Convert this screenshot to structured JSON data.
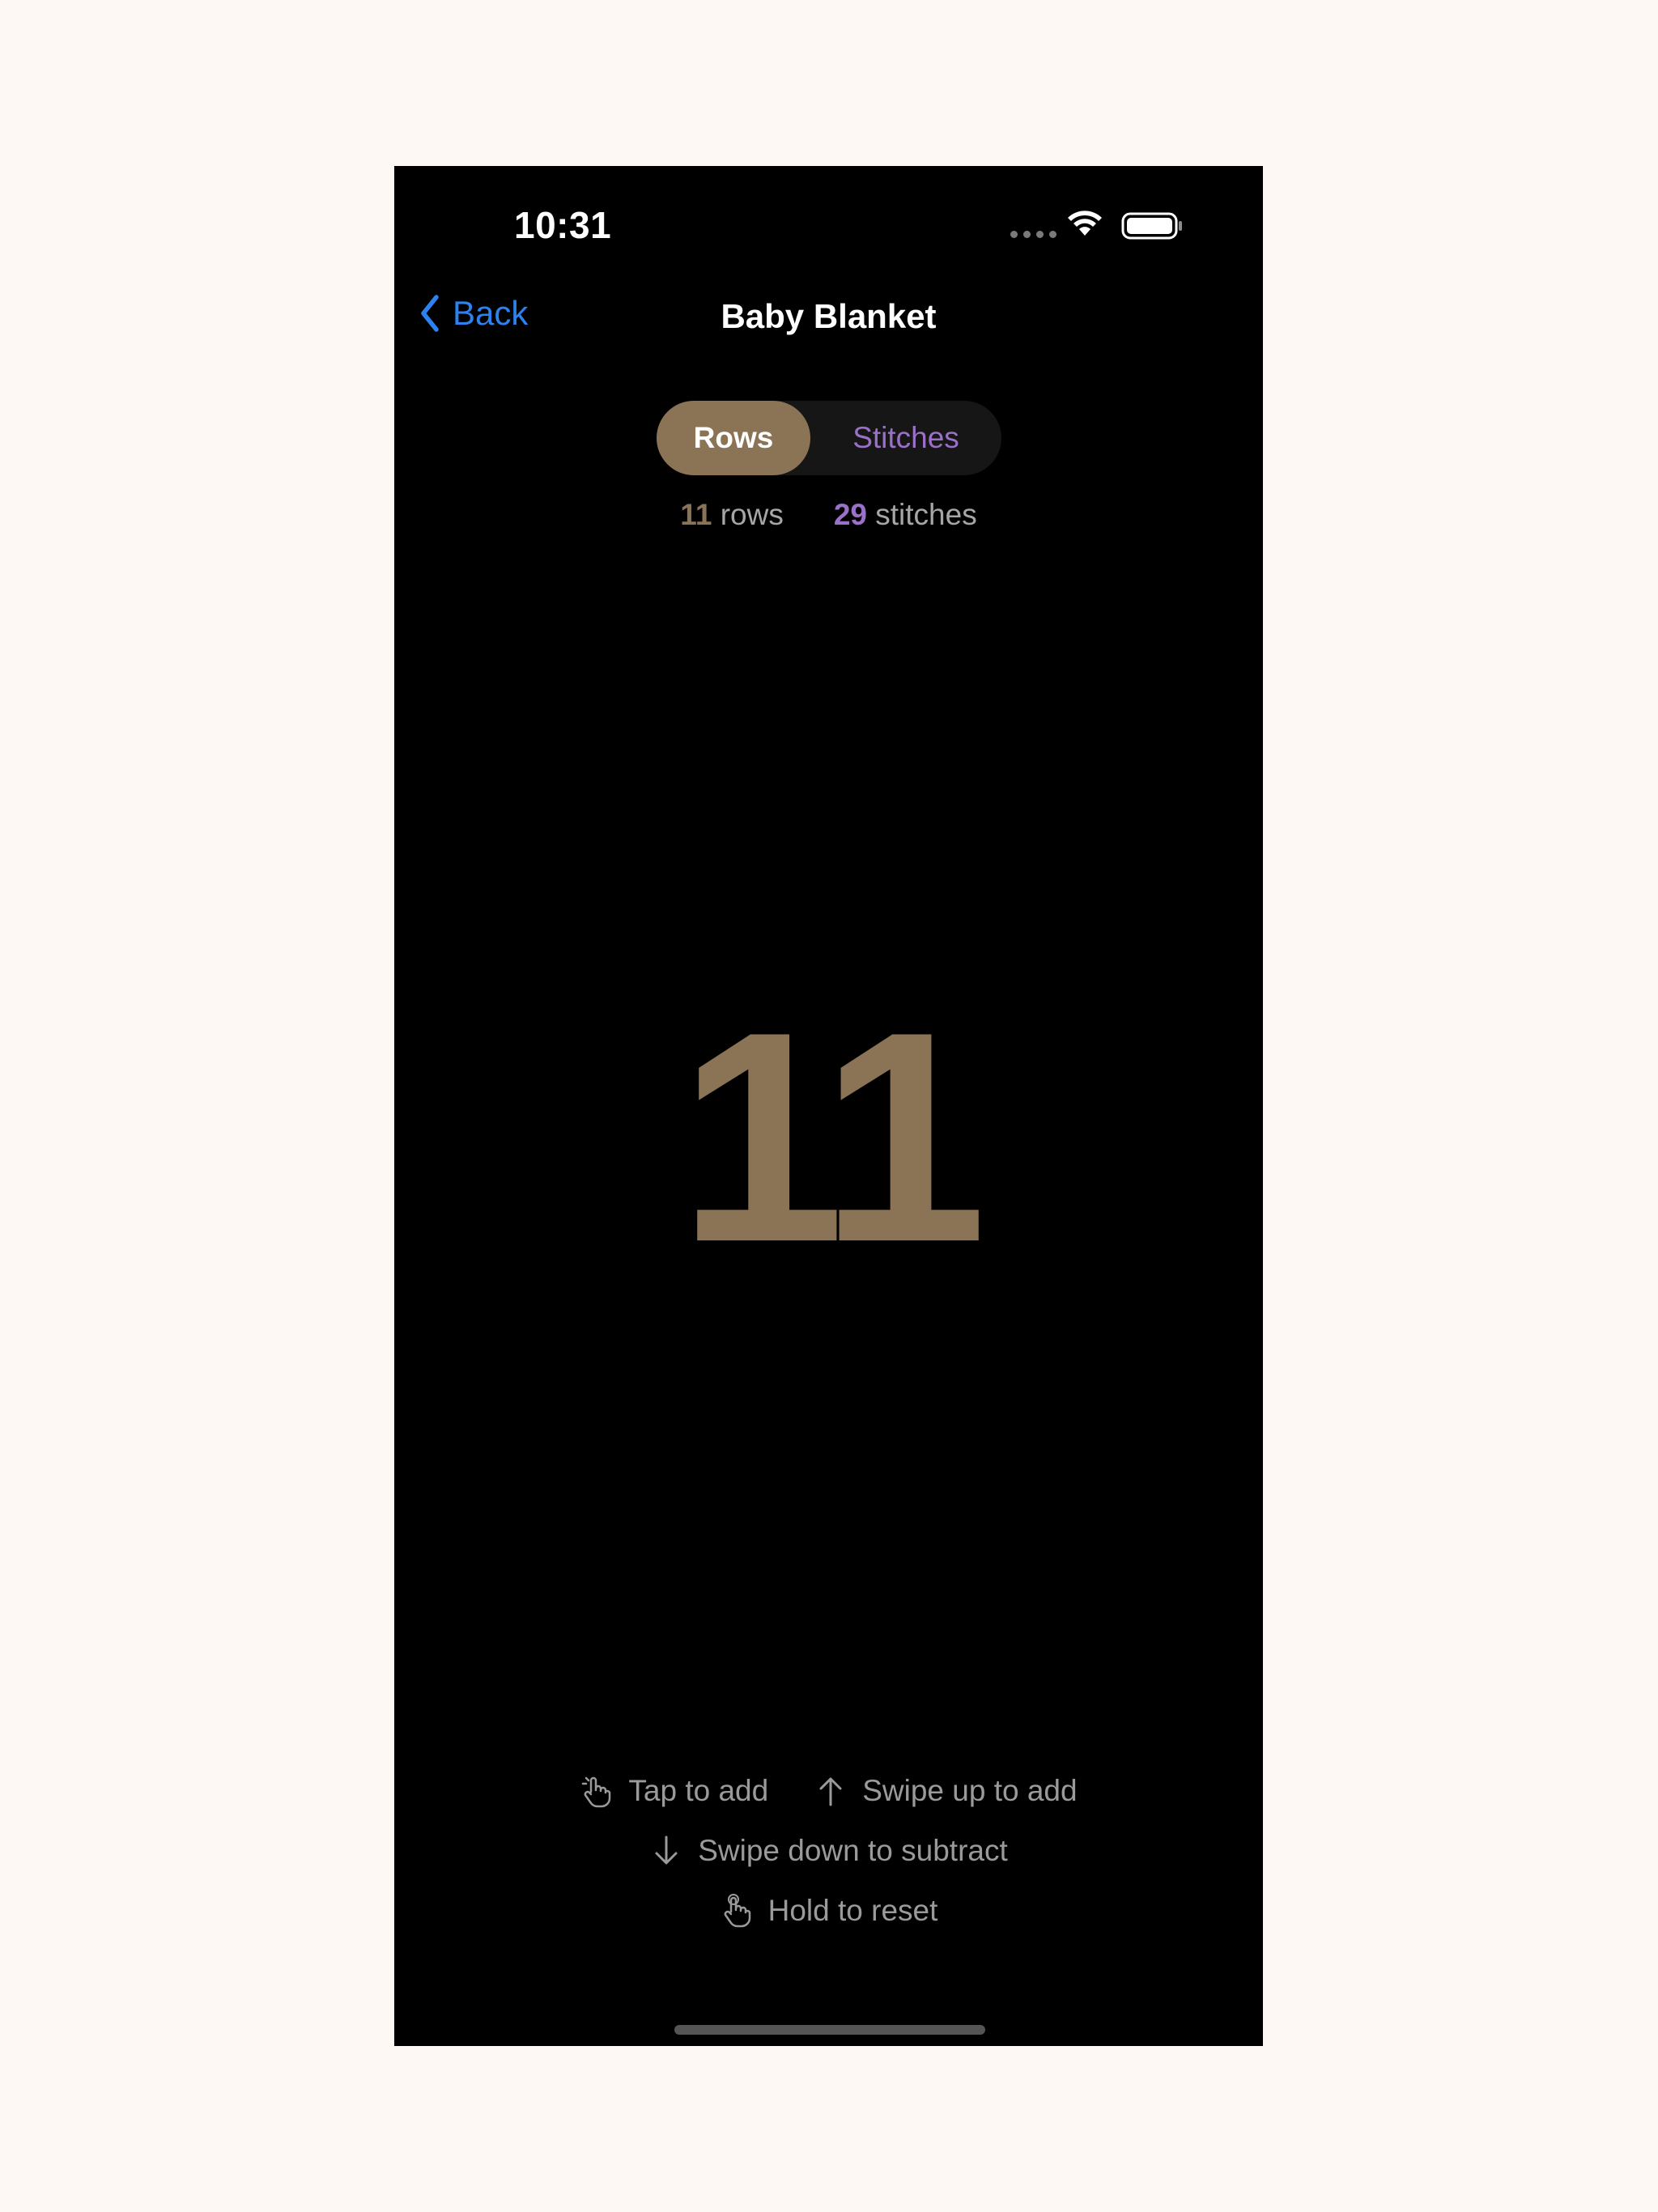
{
  "status_bar": {
    "time": "10:31"
  },
  "nav": {
    "back_label": "Back",
    "title": "Baby Blanket"
  },
  "segments": {
    "rows_label": "Rows",
    "stitches_label": "Stitches",
    "selected": "Rows"
  },
  "summary": {
    "rows_count": "11",
    "rows_unit": "rows",
    "stitches_count": "29",
    "stitches_unit": "stitches"
  },
  "counter": {
    "value": "11"
  },
  "hints": {
    "tap": "Tap to add",
    "swipe_up": "Swipe up to add",
    "swipe_down": "Swipe down to subtract",
    "hold": "Hold to reset"
  },
  "colors": {
    "accent_rows": "#8b7355",
    "accent_stitches": "#9a70c8",
    "link_blue": "#2b82f0",
    "background": "#000000"
  },
  "icons": {
    "back": "chevron-left-icon",
    "tap": "hand-tap-icon",
    "swipe_up": "arrow-up-icon",
    "swipe_down": "arrow-down-icon",
    "hold": "hand-hold-icon"
  }
}
